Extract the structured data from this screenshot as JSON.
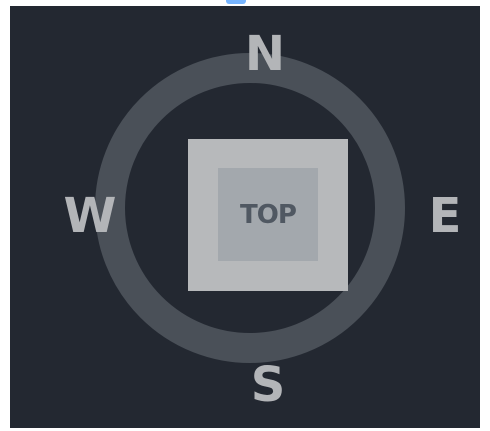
{
  "view_cube": {
    "face_label": "TOP",
    "compass": {
      "north": "N",
      "south": "S",
      "east": "E",
      "west": "W"
    }
  },
  "colors": {
    "panel_background": "#232831",
    "ring": "#4a5058",
    "cube_outer": "#b7b9bb",
    "cube_face": "#a3a8ad",
    "face_label": "#505862",
    "compass_label": "#b3b5b8",
    "accent": "#5fa8ff"
  }
}
